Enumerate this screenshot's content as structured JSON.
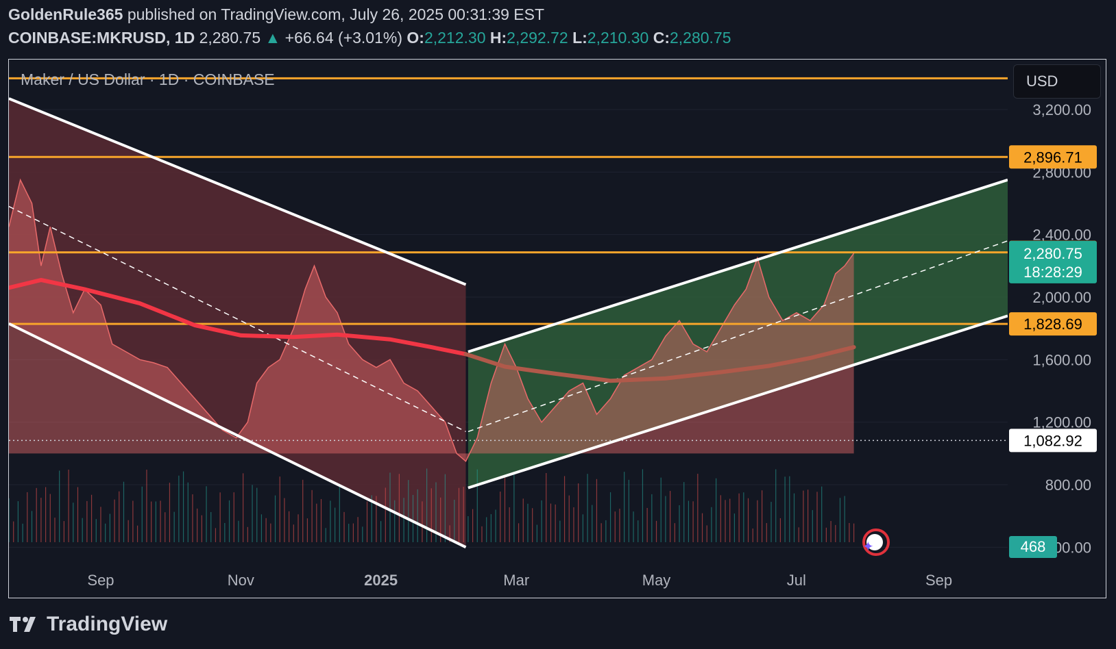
{
  "header": {
    "author": "GoldenRule365",
    "published_text": "published on TradingView.com, July 26, 2025 00:31:39 EST",
    "symbol": "COINBASE:MKRUSD, 1D",
    "price": "2,280.75",
    "change_arrow": "▲",
    "change": "+66.64 (+3.01%)",
    "o_label": "O:",
    "o_value": "2,212.30",
    "h_label": "H:",
    "h_value": "2,292.72",
    "l_label": "L:",
    "l_value": "2,210.30",
    "c_label": "C:",
    "c_value": "2,280.75"
  },
  "chart_title": "Maker / US Dollar · 1D · COINBASE",
  "currency_button": "USD",
  "footer": {
    "brand": "TradingView"
  },
  "colors": {
    "background": "#131722",
    "up": "#26a69a",
    "down": "#ef5350",
    "orange": "#f7a52b",
    "green_zone": "#2e5d3a",
    "red_zone": "#5a2a33",
    "white_channel": "#ffffff",
    "ma_red": "#f23645",
    "ma_brown": "#b0594a"
  },
  "chart_data": {
    "type": "line",
    "title": "Maker / US Dollar · 1D · COINBASE",
    "y_ticks": [
      {
        "value": 3200,
        "label": "3,200.00"
      },
      {
        "value": 2800,
        "label": "2,800.00"
      },
      {
        "value": 2400,
        "label": "2,400.00"
      },
      {
        "value": 2000,
        "label": "2,000.00"
      },
      {
        "value": 1600,
        "label": "1,600.00"
      },
      {
        "value": 1200,
        "label": "1,200.00"
      },
      {
        "value": 800,
        "label": "800.00"
      },
      {
        "value": 400,
        "label": "400.00"
      }
    ],
    "x_ticks": [
      {
        "date": "2024-09-01",
        "label": "Sep"
      },
      {
        "date": "2024-11-01",
        "label": "Nov"
      },
      {
        "date": "2025-01-01",
        "label": "2025"
      },
      {
        "date": "2025-03-01",
        "label": "Mar"
      },
      {
        "date": "2025-05-01",
        "label": "May"
      },
      {
        "date": "2025-07-01",
        "label": "Jul"
      },
      {
        "date": "2025-09-01",
        "label": "Sep"
      }
    ],
    "ylim": [
      400,
      3400
    ],
    "xlim": [
      "2024-07-23",
      "2025-10-01"
    ],
    "horizontal_levels": [
      {
        "value": 3400,
        "label": "",
        "color": "#f7a52b"
      },
      {
        "value": 2896.71,
        "label": "2,896.71",
        "color": "#f7a52b"
      },
      {
        "value": 2286.48,
        "label": "2,286.48",
        "color": "#f7a52b"
      },
      {
        "value": 1828.69,
        "label": "1,828.69",
        "color": "#f7a52b"
      }
    ],
    "dotted_level": {
      "value": 1082.92,
      "label": "1,082.92"
    },
    "last_price": {
      "value": 2280.75,
      "label": "2,280.75",
      "countdown": "18:28:29"
    },
    "volume_label": "468",
    "price_series": [
      [
        "2024-07-23",
        2450
      ],
      [
        "2024-07-28",
        2750
      ],
      [
        "2024-08-02",
        2600
      ],
      [
        "2024-08-06",
        2200
      ],
      [
        "2024-08-10",
        2450
      ],
      [
        "2024-08-15",
        2150
      ],
      [
        "2024-08-20",
        1900
      ],
      [
        "2024-08-25",
        2050
      ],
      [
        "2024-09-01",
        1950
      ],
      [
        "2024-09-06",
        1700
      ],
      [
        "2024-09-12",
        1650
      ],
      [
        "2024-09-18",
        1600
      ],
      [
        "2024-09-24",
        1580
      ],
      [
        "2024-09-30",
        1550
      ],
      [
        "2024-10-06",
        1450
      ],
      [
        "2024-10-12",
        1350
      ],
      [
        "2024-10-18",
        1250
      ],
      [
        "2024-10-24",
        1150
      ],
      [
        "2024-10-30",
        1100
      ],
      [
        "2024-11-04",
        1200
      ],
      [
        "2024-11-08",
        1450
      ],
      [
        "2024-11-13",
        1550
      ],
      [
        "2024-11-18",
        1600
      ],
      [
        "2024-11-24",
        1800
      ],
      [
        "2024-11-29",
        2050
      ],
      [
        "2024-12-03",
        2200
      ],
      [
        "2024-12-08",
        2000
      ],
      [
        "2024-12-13",
        1900
      ],
      [
        "2024-12-18",
        1700
      ],
      [
        "2024-12-24",
        1600
      ],
      [
        "2024-12-30",
        1550
      ],
      [
        "2025-01-05",
        1600
      ],
      [
        "2025-01-11",
        1450
      ],
      [
        "2025-01-17",
        1400
      ],
      [
        "2025-01-23",
        1300
      ],
      [
        "2025-01-29",
        1200
      ],
      [
        "2025-02-03",
        1000
      ],
      [
        "2025-02-07",
        950
      ],
      [
        "2025-02-12",
        1100
      ],
      [
        "2025-02-18",
        1450
      ],
      [
        "2025-02-24",
        1700
      ],
      [
        "2025-03-01",
        1550
      ],
      [
        "2025-03-06",
        1350
      ],
      [
        "2025-03-12",
        1200
      ],
      [
        "2025-03-18",
        1300
      ],
      [
        "2025-03-24",
        1400
      ],
      [
        "2025-03-30",
        1450
      ],
      [
        "2025-04-05",
        1250
      ],
      [
        "2025-04-11",
        1350
      ],
      [
        "2025-04-17",
        1500
      ],
      [
        "2025-04-23",
        1550
      ],
      [
        "2025-04-29",
        1600
      ],
      [
        "2025-05-05",
        1750
      ],
      [
        "2025-05-11",
        1850
      ],
      [
        "2025-05-17",
        1700
      ],
      [
        "2025-05-23",
        1650
      ],
      [
        "2025-05-29",
        1800
      ],
      [
        "2025-06-04",
        1950
      ],
      [
        "2025-06-09",
        2050
      ],
      [
        "2025-06-14",
        2250
      ],
      [
        "2025-06-19",
        2000
      ],
      [
        "2025-06-25",
        1850
      ],
      [
        "2025-07-01",
        1900
      ],
      [
        "2025-07-07",
        1850
      ],
      [
        "2025-07-13",
        1950
      ],
      [
        "2025-07-18",
        2150
      ],
      [
        "2025-07-22",
        2200
      ],
      [
        "2025-07-26",
        2280.75
      ]
    ],
    "ma_series": [
      [
        "2024-07-23",
        2060
      ],
      [
        "2024-08-06",
        2110
      ],
      [
        "2024-08-25",
        2050
      ],
      [
        "2024-09-18",
        1960
      ],
      [
        "2024-10-12",
        1820
      ],
      [
        "2024-11-01",
        1755
      ],
      [
        "2024-11-24",
        1745
      ],
      [
        "2024-12-13",
        1760
      ],
      [
        "2025-01-05",
        1730
      ],
      [
        "2025-01-23",
        1680
      ],
      [
        "2025-02-07",
        1635
      ],
      [
        "2025-02-24",
        1555
      ],
      [
        "2025-03-18",
        1510
      ],
      [
        "2025-04-11",
        1465
      ],
      [
        "2025-05-05",
        1480
      ],
      [
        "2025-05-29",
        1520
      ],
      [
        "2025-06-19",
        1560
      ],
      [
        "2025-07-07",
        1610
      ],
      [
        "2025-07-26",
        1680
      ]
    ],
    "descending_channel": {
      "upper": [
        [
          "2024-07-23",
          3270
        ],
        [
          "2025-02-07",
          2080
        ]
      ],
      "lower": [
        [
          "2024-07-23",
          1830
        ],
        [
          "2025-02-07",
          400
        ]
      ],
      "mid": [
        [
          "2024-07-23",
          2580
        ],
        [
          "2025-02-07",
          1140
        ]
      ]
    },
    "ascending_channel": {
      "upper": [
        [
          "2025-02-08",
          1650
        ],
        [
          "2025-10-01",
          2750
        ]
      ],
      "lower": [
        [
          "2025-02-08",
          780
        ],
        [
          "2025-10-01",
          1880
        ]
      ],
      "mid": [
        [
          "2025-02-08",
          1140
        ],
        [
          "2025-10-01",
          2360
        ]
      ]
    },
    "volume_axis_note": "volume histogram bars at bottom"
  }
}
